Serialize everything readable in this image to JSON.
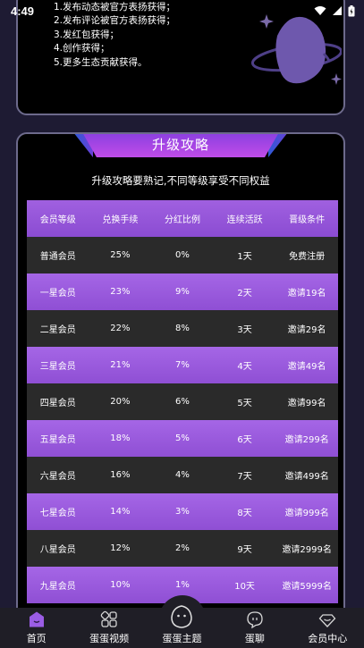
{
  "status_bar": {
    "time": "4:49"
  },
  "rules": {
    "items": [
      "1.发布动态被官方表扬获得；",
      "2.发布评论被官方表扬获得；",
      "3.发红包获得；",
      "4.创作获得；",
      "5.更多生态贡献获得。"
    ]
  },
  "upgrade": {
    "title": "升级攻略",
    "subtitle": "升级攻略要熟记,不同等级享受不同权益",
    "columns": [
      "会员等级",
      "兑换手续",
      "分红比例",
      "连续活跃",
      "晋级条件"
    ],
    "rows": [
      [
        "普通会员",
        "25%",
        "0%",
        "1天",
        "免费注册"
      ],
      [
        "一星会员",
        "23%",
        "9%",
        "2天",
        "邀请19名"
      ],
      [
        "二星会员",
        "22%",
        "8%",
        "3天",
        "邀请29名"
      ],
      [
        "三星会员",
        "21%",
        "7%",
        "4天",
        "邀请49名"
      ],
      [
        "四星会员",
        "20%",
        "6%",
        "5天",
        "邀请99名"
      ],
      [
        "五星会员",
        "18%",
        "5%",
        "6天",
        "邀请299名"
      ],
      [
        "六星会员",
        "16%",
        "4%",
        "7天",
        "邀请499名"
      ],
      [
        "七星会员",
        "14%",
        "3%",
        "8天",
        "邀请999名"
      ],
      [
        "八星会员",
        "12%",
        "2%",
        "9天",
        "邀请2999名"
      ],
      [
        "九星会员",
        "10%",
        "1%",
        "10天",
        "邀请5999名"
      ]
    ]
  },
  "nav": {
    "items": [
      {
        "label": "首页",
        "icon": "home-icon",
        "active": true
      },
      {
        "label": "蛋蛋视频",
        "icon": "video-grid-icon"
      },
      {
        "label": "蛋蛋主题",
        "icon": "egg-icon"
      },
      {
        "label": "蛋聊",
        "icon": "chat-bubble-icon"
      },
      {
        "label": "会员中心",
        "icon": "member-heart-icon"
      }
    ]
  },
  "colors": {
    "accent": "#9b5de5",
    "background": "#1e1b33",
    "card": "#000000"
  }
}
